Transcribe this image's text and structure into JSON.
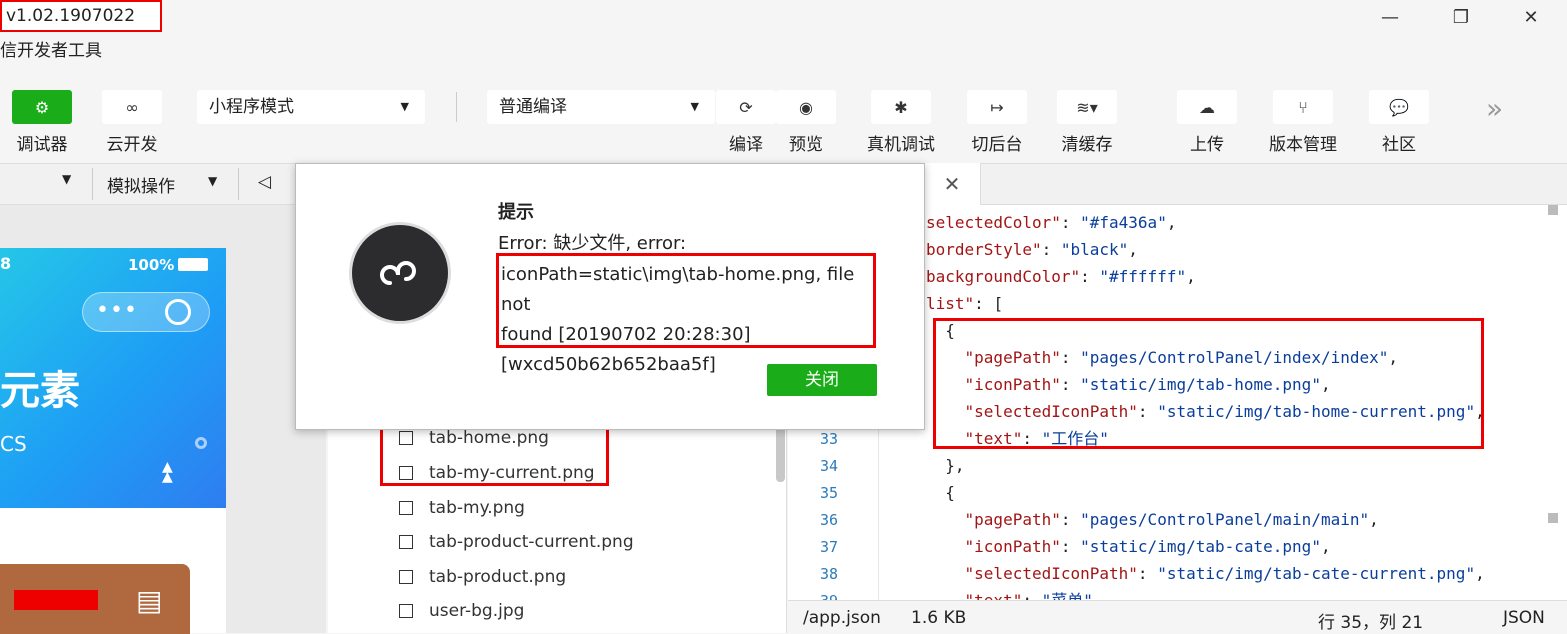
{
  "window": {
    "version": "v1.02.1907022",
    "app_title": "信开发者工具",
    "minimize": "—",
    "maximize": "❐",
    "close": "✕"
  },
  "toolbar": {
    "debugger_label": "调试器",
    "cloud_label": "云开发",
    "mode_select": "小程序模式",
    "compile_select": "普通编译",
    "compile_label": "编译",
    "preview_label": "预览",
    "device_debug_label": "真机调试",
    "background_label": "切后台",
    "clear_cache_label": "清缓存",
    "upload_label": "上传",
    "version_mgmt_label": "版本管理",
    "community_label": "社区",
    "more": "»"
  },
  "simbar": {
    "sim_ops": "模拟操作"
  },
  "phone": {
    "time": "8",
    "battery": "100%",
    "banner_text": "元素",
    "banner_sub": "CS"
  },
  "dialog": {
    "title": "提示",
    "line1": "Error: 缺少文件, error:",
    "msg_lines": [
      "iconPath=static\\img\\tab-home.png, file not",
      "found [20190702 20:28:30]",
      "[wxcd50b62b652baa5f]"
    ],
    "close_label": "关闭"
  },
  "files": [
    "tab-home.png",
    "tab-my-current.png",
    "tab-my.png",
    "tab-product-current.png",
    "tab-product.png",
    "user-bg.jpg"
  ],
  "editor": {
    "line_numbers": [
      "33",
      "34",
      "35",
      "36",
      "37",
      "38",
      "39"
    ],
    "status_path": "/app.json",
    "status_size": "1.6 KB",
    "status_pos": "行 35，列 21",
    "status_lang": "JSON"
  }
}
